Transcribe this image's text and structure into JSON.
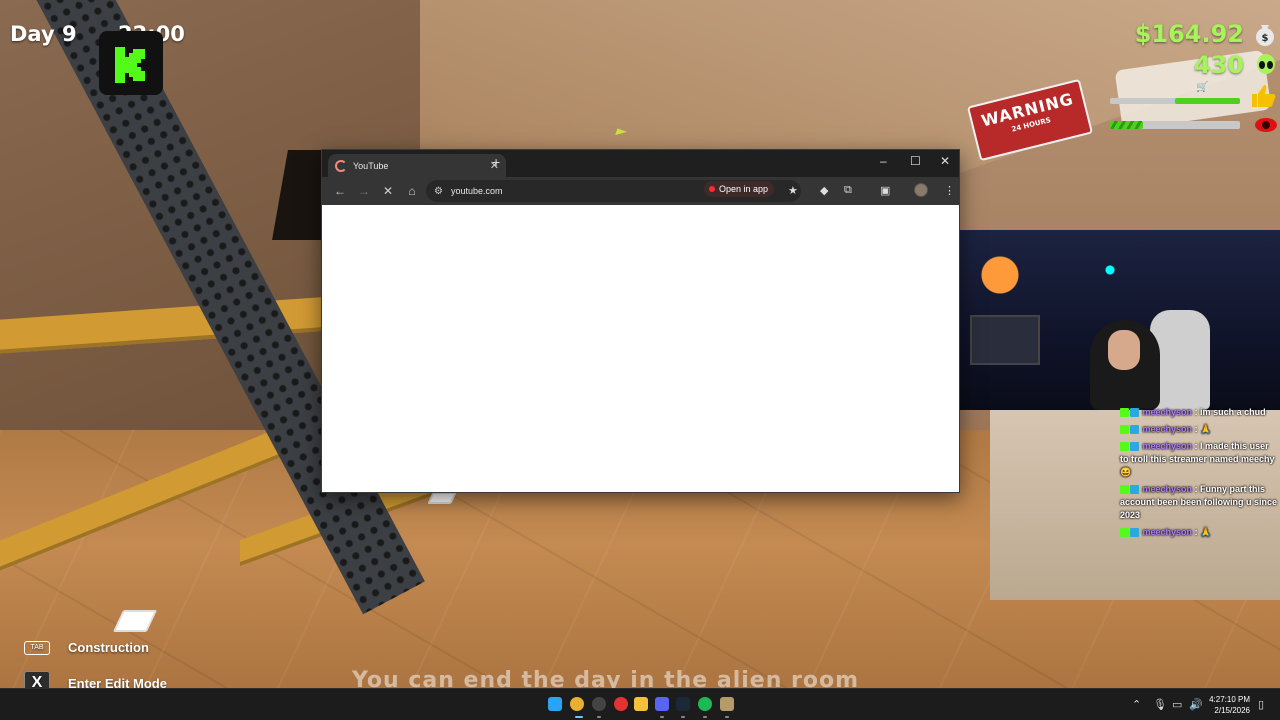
{
  "hud": {
    "day": "Day 9",
    "time": "22:00",
    "money": "$164.92",
    "aliens": "430",
    "hints": [
      {
        "key": "TAB",
        "label": "Construction"
      },
      {
        "key": "X",
        "label": "Enter Edit Mode"
      }
    ],
    "subtitle": "You can end the day in the alien room",
    "accent_color": "#a8f35b"
  },
  "scene": {
    "warning_sign_title": "WARNING",
    "warning_sign_sub": "24 HOURS"
  },
  "browser": {
    "tab_title": "YouTube",
    "url": "youtube.com",
    "open_in_app": "Open in app",
    "icons": [
      "back-icon",
      "forward-icon",
      "stop-loading-icon",
      "home-icon",
      "site-settings-icon",
      "bookmark-star-icon",
      "extension-icon",
      "puzzle-icon",
      "side-panel-icon",
      "menu-icon"
    ]
  },
  "chat": {
    "messages": [
      {
        "user": "meechyson",
        "text": ": im such a chud"
      },
      {
        "user": "meechyson",
        "text": ": 🙏"
      },
      {
        "user": "meechyson",
        "text": ": I made this user to troll this streamer named meechy 😆"
      },
      {
        "user": "meechyson",
        "text": ": Funny part this account been been following u since 2023"
      },
      {
        "user": "meechyson",
        "text": ": 🙏"
      }
    ]
  },
  "taskbar": {
    "time": "4:27:10 PM",
    "date": "2/15/2026"
  }
}
